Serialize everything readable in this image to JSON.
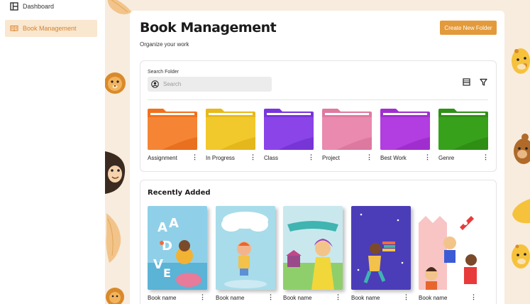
{
  "sidebar": {
    "items": [
      {
        "label": "Dashboard",
        "icon": "layout-icon",
        "active": false
      },
      {
        "label": "Book Management",
        "icon": "book-open-icon",
        "active": true
      }
    ]
  },
  "header": {
    "title": "Book Management",
    "subtitle": "Organize your work",
    "create_button_label": "Create New Folder"
  },
  "search": {
    "label": "Search Folder",
    "placeholder": "Search",
    "value": ""
  },
  "toolbar": {
    "list_view_icon": "list-icon",
    "filter_icon": "filter-icon"
  },
  "folders": [
    {
      "label": "Assignment",
      "color": "#f2711c"
    },
    {
      "label": "In Progress",
      "color": "#f2c92c"
    },
    {
      "label": "Class",
      "color": "#8a44e8"
    },
    {
      "label": "Project",
      "color": "#e98aae"
    },
    {
      "label": "Best Work",
      "color": "#b23de0"
    },
    {
      "label": "Genre",
      "color": "#37a11c"
    }
  ],
  "recent": {
    "title": "Recently Added",
    "books": [
      {
        "label": "Book name"
      },
      {
        "label": "Book name"
      },
      {
        "label": "Book name"
      },
      {
        "label": "Book name"
      },
      {
        "label": "Book name"
      }
    ]
  },
  "colors": {
    "accent": "#e39a3b",
    "background": "#f7ecde",
    "active_nav_bg": "#f9e7d0"
  }
}
